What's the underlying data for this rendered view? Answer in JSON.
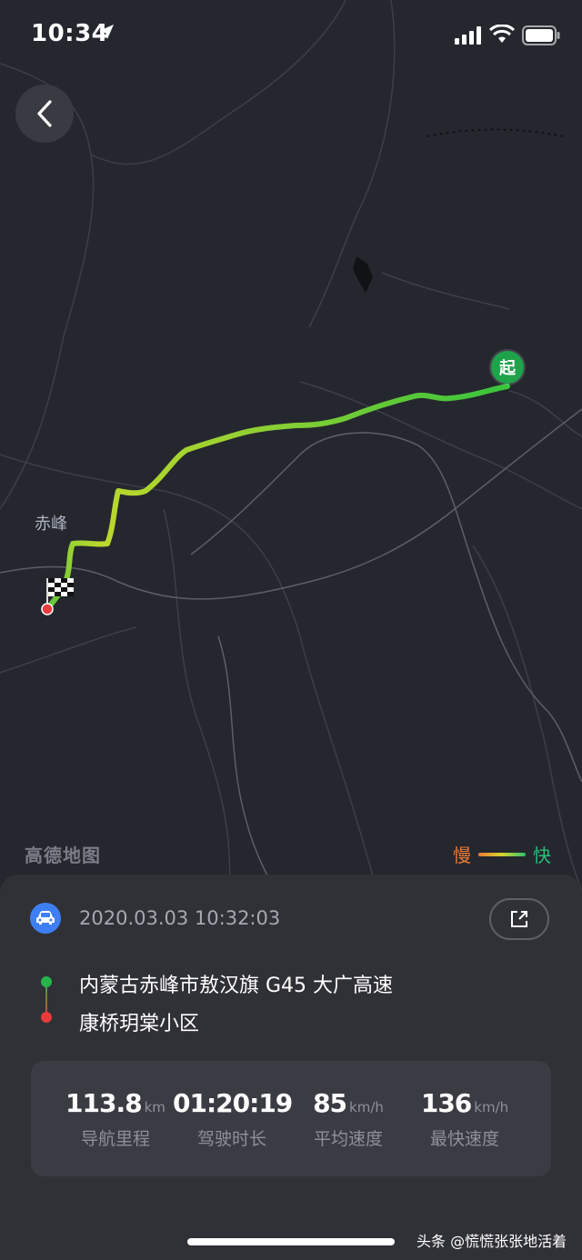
{
  "status": {
    "time": "10:34"
  },
  "map": {
    "city_label": "赤峰",
    "start_pin": "起",
    "provider": "高德地图",
    "legend": {
      "slow": "慢",
      "fast": "快"
    },
    "colors": {
      "route_start": "#2fbf3a",
      "route_end": "#d6d630",
      "start_pin": "#1fa34a",
      "end_pin": "#e83b3b"
    }
  },
  "trip": {
    "datetime": "2020.03.03 10:32:03",
    "from": "内蒙古赤峰市敖汉旗 G45 大广高速",
    "to": "康桥玥棠小区",
    "stats": [
      {
        "value": "113.8",
        "unit": "km",
        "label": "导航里程"
      },
      {
        "value": "01:20:19",
        "unit": "",
        "label": "驾驶时长"
      },
      {
        "value": "85",
        "unit": "km/h",
        "label": "平均速度"
      },
      {
        "value": "136",
        "unit": "km/h",
        "label": "最快速度"
      }
    ]
  },
  "watermark": "头条 @慌慌张张地活着",
  "icons": [
    "location-arrow-icon",
    "signal-icon",
    "wifi-icon",
    "battery-icon",
    "back-chevron-icon",
    "finish-flag-icon",
    "car-icon",
    "share-icon"
  ]
}
